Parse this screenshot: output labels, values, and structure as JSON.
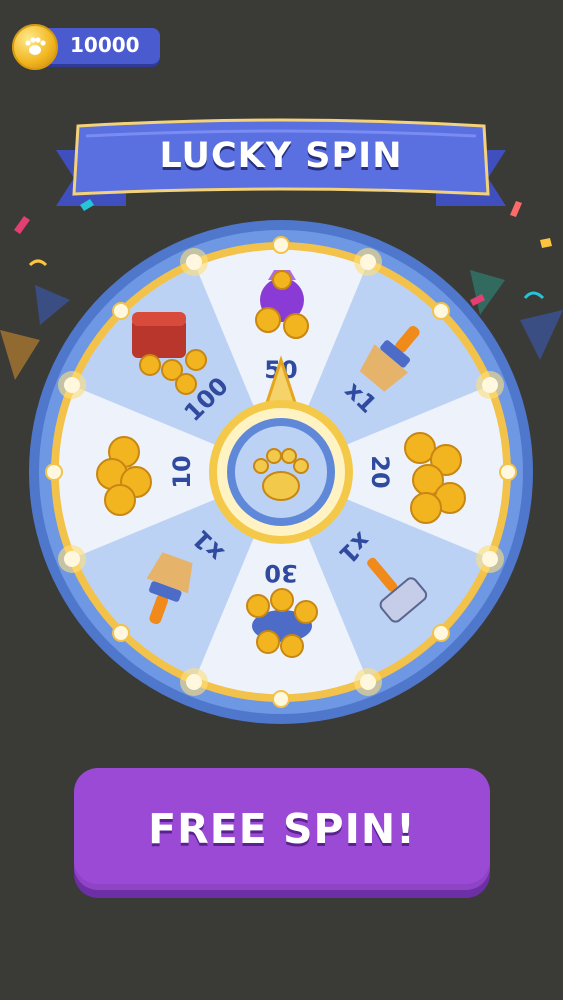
{
  "currency": {
    "amount": "10000",
    "icon": "paw-coin-icon"
  },
  "banner": {
    "title": "LUCKY SPIN"
  },
  "wheel": {
    "segments": [
      {
        "label": "50",
        "reward": "coin-bag"
      },
      {
        "label": "x1",
        "reward": "brush"
      },
      {
        "label": "20",
        "reward": "coin-stack"
      },
      {
        "label": "x1",
        "reward": "hammer"
      },
      {
        "label": "30",
        "reward": "coin-pile"
      },
      {
        "label": "x1",
        "reward": "brush"
      },
      {
        "label": "10",
        "reward": "coin-stack"
      },
      {
        "label": "100",
        "reward": "treasure-chest"
      }
    ],
    "center_icon": "paw-icon"
  },
  "actions": {
    "spin_label": "FREE SPIN!"
  },
  "colors": {
    "background": "#3a3a37",
    "wheel_rim": "#5f88d8",
    "segment_blue": "#bcd2f4",
    "segment_white": "#eef3fb",
    "gold": "#f2b51f",
    "button": "#9b4ad6"
  }
}
